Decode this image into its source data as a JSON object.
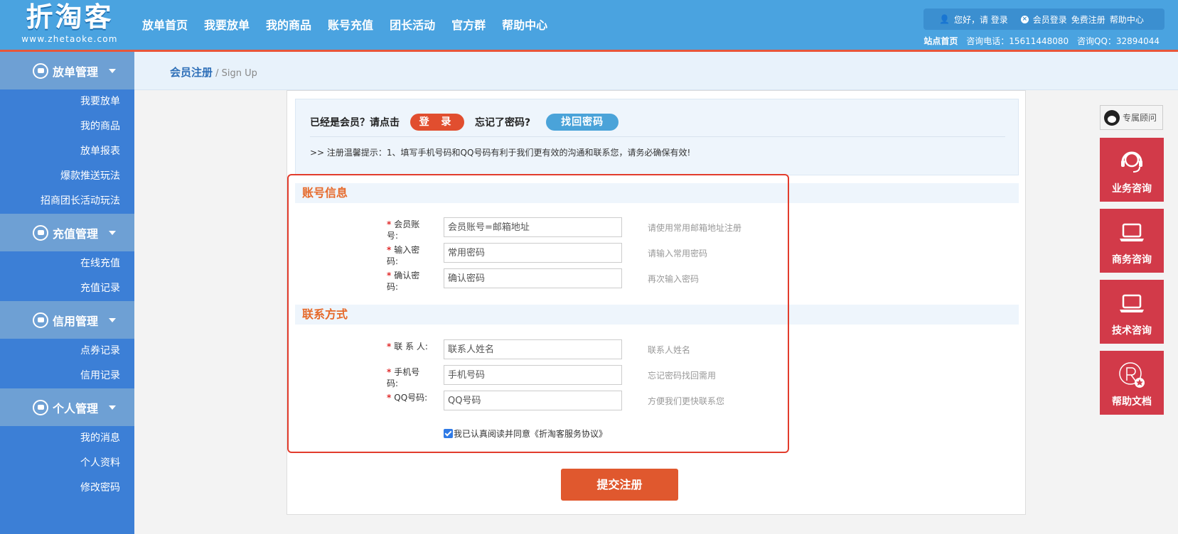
{
  "header": {
    "logo_text": "折淘客",
    "logo_domain": "www.zhetaoke.com",
    "nav": [
      "放单首页",
      "我要放单",
      "我的商品",
      "账号充值",
      "团长活动",
      "官方群",
      "帮助中心"
    ],
    "user_greeting": "您好，请 登录",
    "member_login": "会员登录",
    "free_register": "免费注册",
    "help_center": "帮助中心",
    "site_home": "站点首页",
    "phone": "咨询电话：15611448080",
    "qq": "咨询QQ：32894044"
  },
  "sidebar": {
    "groups": [
      {
        "title": "放单管理",
        "items": [
          "我要放单",
          "我的商品",
          "放单报表",
          "爆款推送玩法",
          "招商团长活动玩法"
        ]
      },
      {
        "title": "充值管理",
        "items": [
          "在线充值",
          "充值记录"
        ]
      },
      {
        "title": "信用管理",
        "items": [
          "点券记录",
          "信用记录"
        ]
      },
      {
        "title": "个人管理",
        "items": [
          "我的消息",
          "个人资料",
          "修改密码"
        ]
      }
    ]
  },
  "breadcrumb": {
    "title": "会员注册",
    "sub": " / Sign Up"
  },
  "notice": {
    "already_member": "已经是会员？请点击",
    "login_button": "登 录",
    "forgot": "忘记了密码?",
    "recover_button": "找回密码",
    "tip": ">> 注册温馨提示：1、填写手机号码和QQ号码有利于我们更有效的沟通和联系您，请务必确保有效!"
  },
  "form": {
    "account_section": "账号信息",
    "contact_section": "联系方式",
    "required_mark": "*",
    "fields": [
      {
        "label": "会员账号:",
        "placeholder": "会员账号=邮箱地址",
        "hint": "请使用常用邮箱地址注册"
      },
      {
        "label": "输入密码:",
        "placeholder": "常用密码",
        "hint": "请输入常用密码"
      },
      {
        "label": "确认密码:",
        "placeholder": "确认密码",
        "hint": "再次输入密码"
      },
      {
        "label": "联 系 人:",
        "placeholder": "联系人姓名",
        "hint": "联系人姓名"
      },
      {
        "label": "手机号码:",
        "placeholder": "手机号码",
        "hint": "忘记密码找回需用"
      },
      {
        "label": "QQ号码:",
        "placeholder": "QQ号码",
        "hint": "方便我们更快联系您"
      }
    ],
    "agree_text": "我已认真阅读并同意《折淘客服务协议》",
    "agree_checked": true,
    "submit": "提交注册"
  },
  "right_float": {
    "advisor": "专属顾问",
    "boxes": [
      "业务咨询",
      "商务咨询",
      "技术咨询",
      "帮助文档"
    ]
  },
  "colors": {
    "header_bg": "#4aa3e0",
    "sidebar_bg": "#3c7fd6",
    "accent_orange": "#e0582e",
    "float_red": "#d23a49",
    "highlight_border": "#e23c2c"
  }
}
